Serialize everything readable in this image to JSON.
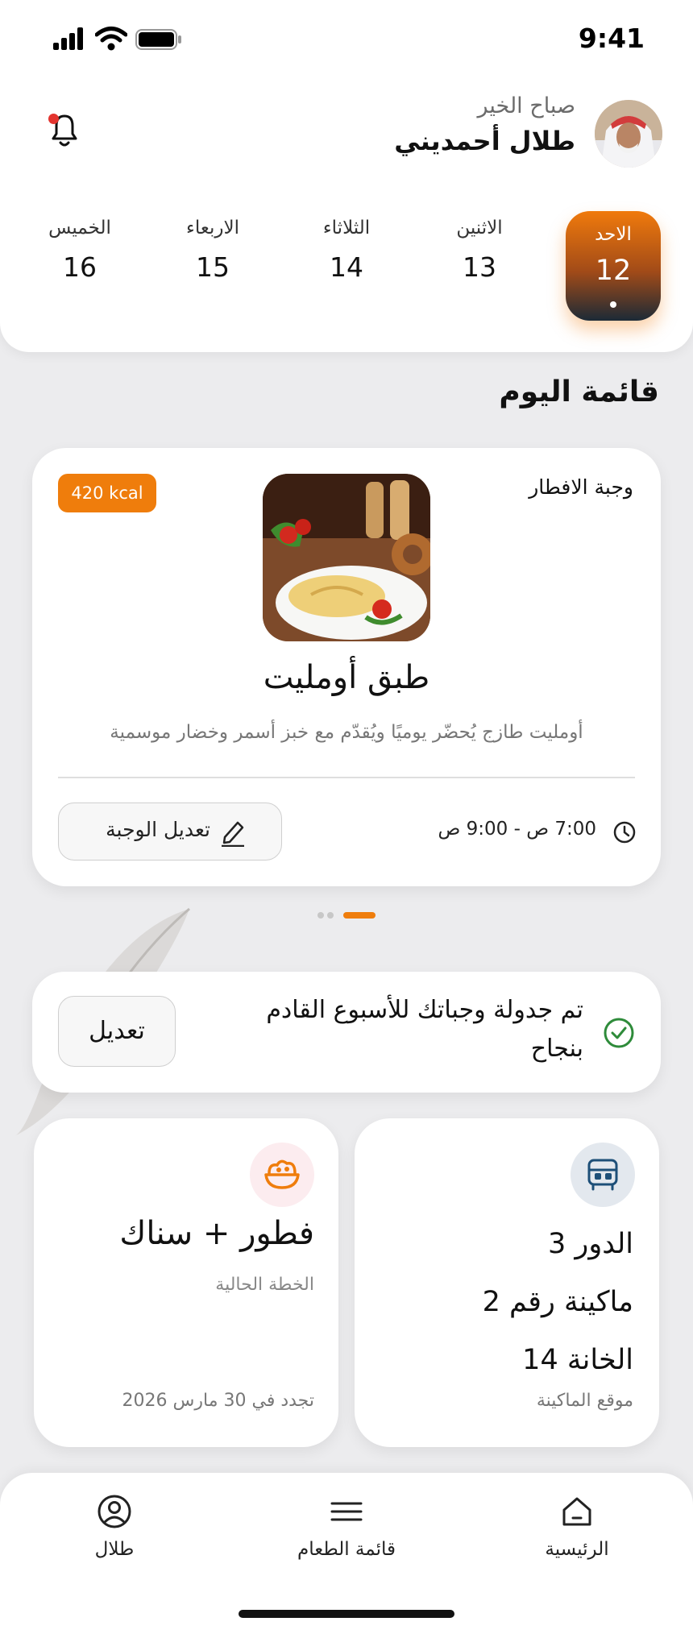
{
  "status_bar": {
    "time": "9:41"
  },
  "header": {
    "greeting": "صباح الخير",
    "user_name": "طلال أحمديني",
    "notification_icon": "bell-icon",
    "has_unread": true
  },
  "days": [
    {
      "name": "الاحد",
      "num": "12",
      "active": true
    },
    {
      "name": "الاثنين",
      "num": "13"
    },
    {
      "name": "الثلاثاء",
      "num": "14"
    },
    {
      "name": "الاربعاء",
      "num": "15"
    },
    {
      "name": "الخميس",
      "num": "16"
    }
  ],
  "today_menu": {
    "title": "قائمة اليوم",
    "meal": {
      "type": "وجبة الافطار",
      "kcal": "420 kcal",
      "name": "طبق أومليت",
      "description": "أومليت طازج يُحضّر يوميًا ويُقدّم مع خبز أسمر وخضار موسمية",
      "time": "7:00 ص - 9:00 ص",
      "edit_label": "تعديل الوجبة"
    },
    "pager": {
      "count": 3,
      "active": 0
    }
  },
  "notice": {
    "text": "تم جدولة وجباتك للأسبوع القادم بنجاح",
    "edit_label": "تعديل"
  },
  "machine": {
    "lines": [
      "الدور 3",
      "ماكينة رقم 2",
      "الخانة 14"
    ],
    "caption": "موقع الماكينة",
    "icon": "vending-machine-icon"
  },
  "plan": {
    "title": "فطور + سناك",
    "caption": "الخطة الحالية",
    "renew": "تجدد في 30 مارس 2026",
    "icon": "salad-bowl-icon"
  },
  "nav": {
    "home": "الرئيسية",
    "menu": "قائمة الطعام",
    "profile": "طلال"
  },
  "colors": {
    "accent": "#ef7d0c",
    "navy": "#1c2a36",
    "success": "#2e8b3a"
  }
}
